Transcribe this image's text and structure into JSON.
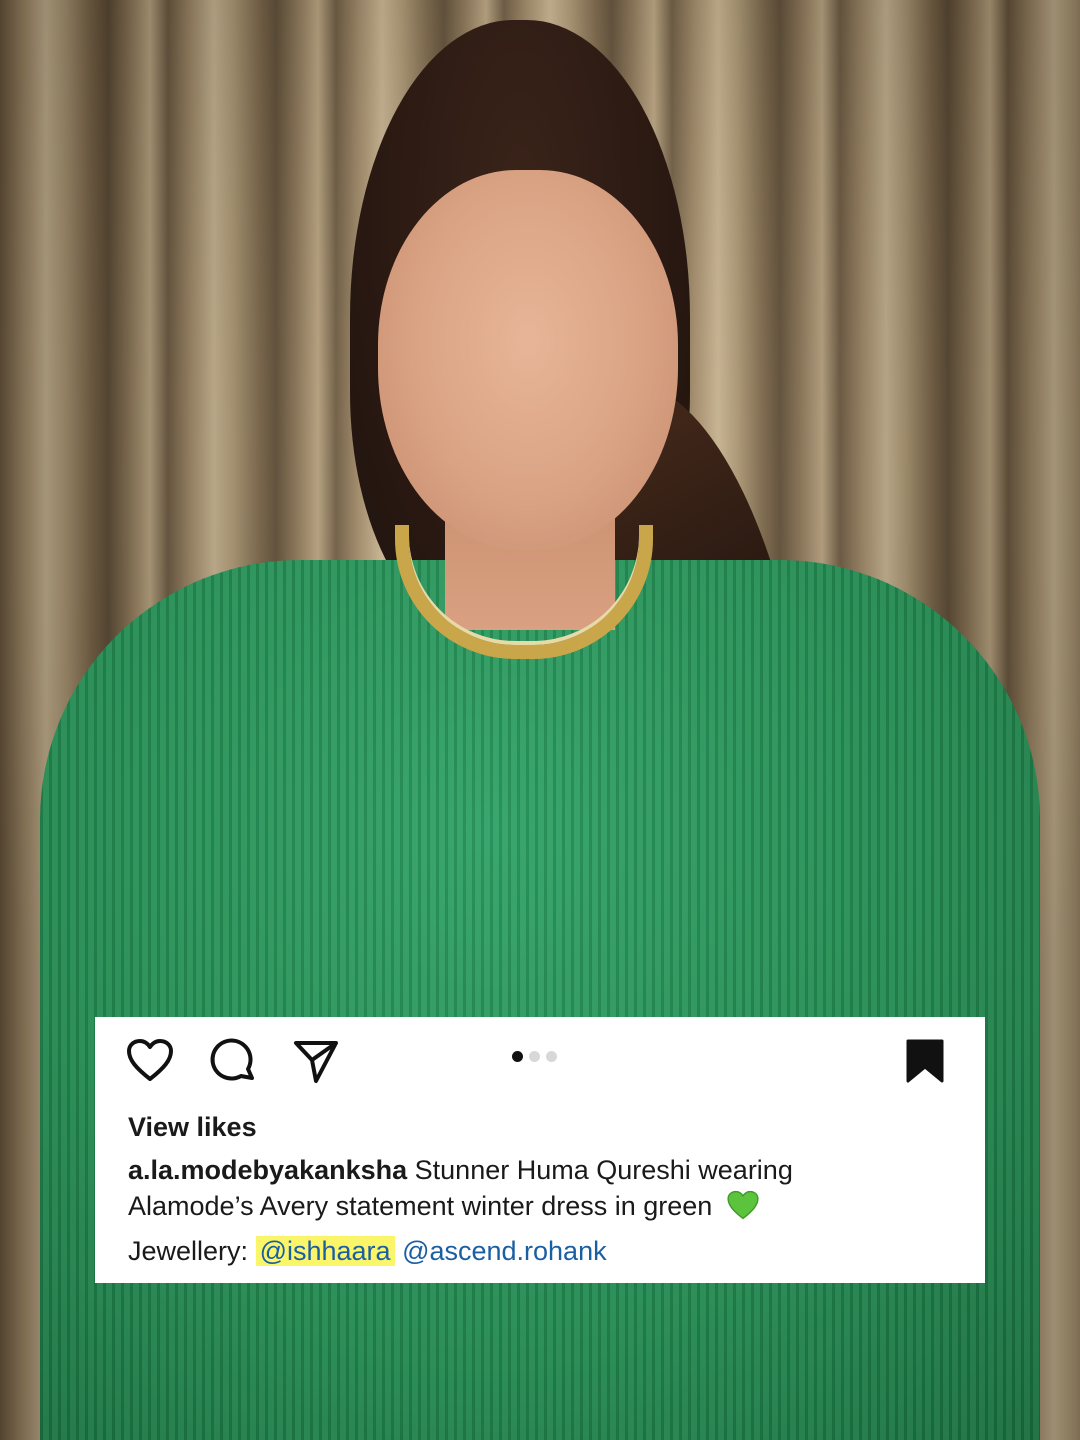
{
  "post": {
    "likes_label": "View likes",
    "username": "a.la.modebyakanksha",
    "caption_line1": "Stunner Huma Qureshi wearing",
    "caption_line2": "Alamode’s Avery statement winter dress in green",
    "caption_emoji": "green-heart-emoji",
    "credits_label": "Jewellery:",
    "mentions": [
      "@ishhaara",
      "@ascend.rohank"
    ]
  },
  "carousel": {
    "total": 3,
    "active_index": 0
  },
  "icons": {
    "like": "heart-outline-icon",
    "comment": "comment-bubble-icon",
    "share": "send-paper-plane-icon",
    "save": "bookmark-filled-icon"
  },
  "colors": {
    "card_bg": "#ffffff",
    "text": "#1a1a1a",
    "mention": "#1b5fa3",
    "highlight": "#fbf56a",
    "dot_active": "#111111",
    "dot_inactive": "#d8d8d8",
    "green_heart": "#5cc33c"
  }
}
